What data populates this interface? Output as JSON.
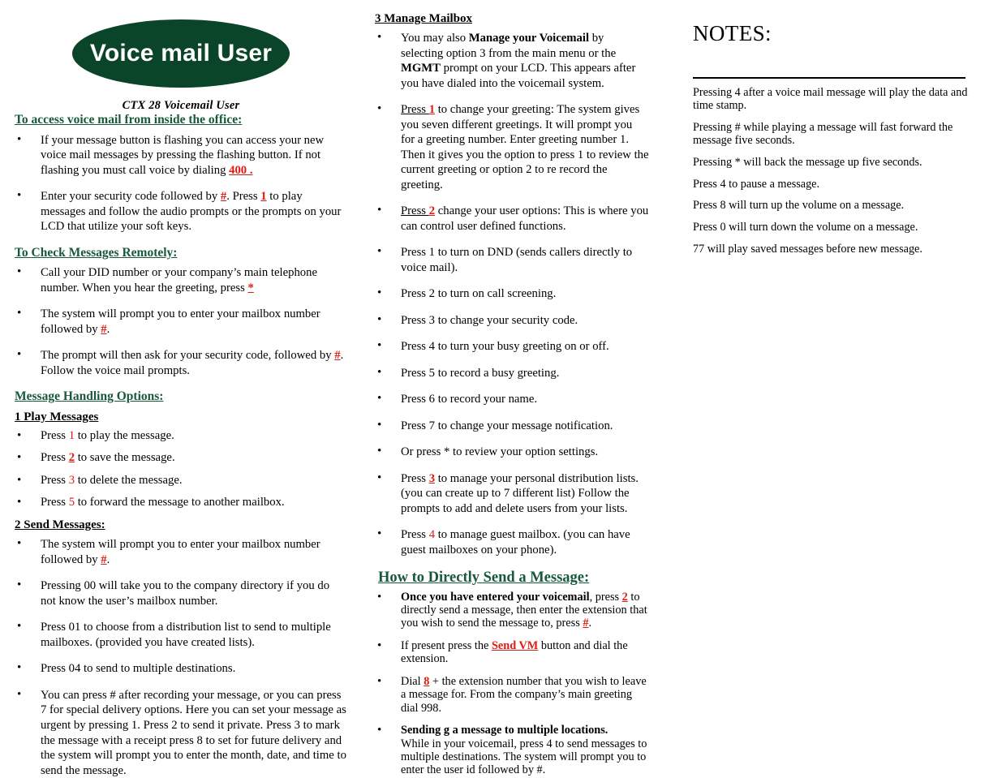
{
  "header": {
    "logo_text": "Voice mail User",
    "logo_color": "#0a4429",
    "subtitle": "CTX 28 Voicemail User"
  },
  "colors": {
    "heading_green": "#18593a",
    "accent_red": "#e01b12",
    "logo_green": "#0a4429"
  },
  "column1": {
    "heading_access": "To access voice mail from inside the office:",
    "access_items": {
      "item1_a": "If your message button is flashing you can access your new voice mail messages by pressing the flashing button. If not flashing you must call voice by dialing ",
      "item1_key": "400 .",
      "item2_a": " Enter your security code followed by ",
      "item2_key1": "#",
      "item2_b": ". Press ",
      "item2_key2": "1",
      "item2_c": " to play messages and follow the audio prompts or the prompts on your LCD that utilize your soft keys."
    },
    "heading_remote": "To Check Messages Remotely:",
    "remote_items": {
      "item1_a": "Call your DID number or your company’s  main telephone number.  When you hear the greeting, press ",
      "item1_key": "*",
      "item2_a": "The system will prompt you to enter your mailbox number followed by ",
      "item2_key": "#",
      "item2_b": ".",
      "item3_a": " The prompt will then ask for your security code, followed by ",
      "item3_key": "#",
      "item3_b": ".  Follow the voice mail prompts."
    },
    "heading_handling": "Message Handling Options:",
    "heading_play": "1 Play Messages",
    "play_items": [
      {
        "pre": "Press ",
        "key": "1",
        "post": " to play the message.",
        "underline": false
      },
      {
        "pre": "Press ",
        "key": "2",
        "post": " to save the message.",
        "underline": true
      },
      {
        "pre": "Press ",
        "key": "3",
        "post": " to delete the message.",
        "underline": false
      },
      {
        "pre": "Press ",
        "key": "5",
        "post": " to forward the message to another mailbox.",
        "underline": false
      }
    ],
    "heading_send": "2 Send Messages:",
    "send_items": {
      "item1_a": "The system will prompt you to enter your mailbox number followed by ",
      "item1_key": "#",
      "item1_b": ".",
      "item2": "Pressing 00 will take you to the company directory if you do not know the user’s mailbox number.",
      "item3": "Press 01 to choose from a distribution list to send to multiple mailboxes. (provided you have created lists).",
      "item4": "Press 04 to send to multiple destinations.",
      "item5": "You can press # after recording your message, or you can press 7 for special delivery options. Here you can set your message as urgent by pressing 1. Press 2 to send it private. Press 3 to mark the message with a receipt press 8 to set for future delivery and the system will prompt you to enter the month, date, and time to send the message."
    }
  },
  "column2": {
    "heading_manage": "3 Manage Mailbox",
    "manage_item1": {
      "a": "You may also ",
      "bold1": "Manage your Voicemail",
      "b": " by selecting option 3 from the main menu or the ",
      "bold2": "MGMT",
      "c": " prompt on your LCD.  This appears after you have dialed into the voicemail system."
    },
    "manage_item2": {
      "press": "Press ",
      "key": "1",
      "rest": " to change your greeting: The system gives you seven different greetings. It will prompt you for a greeting number. Enter greeting number 1. Then it gives you the option to press 1 to review the current greeting or option 2 to re record the greeting."
    },
    "manage_item3": {
      "press": "Press ",
      "key": "2",
      "rest": " change your user options: This is where you can control user defined functions."
    },
    "option_items": [
      "Press 1 to turn on DND (sends callers directly to voice mail).",
      "Press 2 to turn on call screening.",
      "Press 3 to change your security code.",
      "Press 4 to turn your busy greeting on or off.",
      "Press 5 to record a  busy greeting.",
      "Press 6 to record your name.",
      "Press 7 to change your message notification.",
      "Or press * to review your option settings."
    ],
    "manage_item4": {
      "pre": "Press ",
      "key": "3",
      "post": " to manage your personal distribution lists. (you can create up to 7 different list) Follow the prompts to add and delete users from your lists."
    },
    "manage_item5": {
      "pre": "Press ",
      "key": "4",
      "post": " to manage guest mailbox.  (you can have guest mailboxes on your phone)."
    },
    "heading_direct": "How to Directly Send a Message:",
    "direct_items": {
      "item1_bold": "Once you have entered your voicemail",
      "item1_a": ", press ",
      "item1_key1": "2",
      "item1_b": " to directly send a message, then enter the extension that you wish to send the message to, press ",
      "item1_key2": "#",
      "item1_c": ".",
      "item2_a": "If present  press the ",
      "item2_key": "Send VM",
      "item2_b": " button and dial the extension.",
      "item3_a": "Dial ",
      "item3_key": "8",
      "item3_b": " + the extension number that you wish to leave a message for. From the company’s main greeting dial 998.",
      "item4_bold": "Sending g a message to multiple locations.",
      "item4_rest": "While in your voicemail, press 4 to send messages to multiple destinations. The system will prompt you to enter the  user id followed by #."
    }
  },
  "column3": {
    "title": "NOTES:",
    "notes": [
      "Pressing 4 after a voice mail message will play the data and time stamp.",
      "Pressing # while playing a message will fast forward the message five seconds.",
      "Pressing * will back the message up five seconds.",
      "Press 4 to pause a message.",
      "Press 8 will turn up the volume on a message.",
      "Press 0 will turn down the volume on a message.",
      "77 will play saved messages before new message."
    ]
  }
}
